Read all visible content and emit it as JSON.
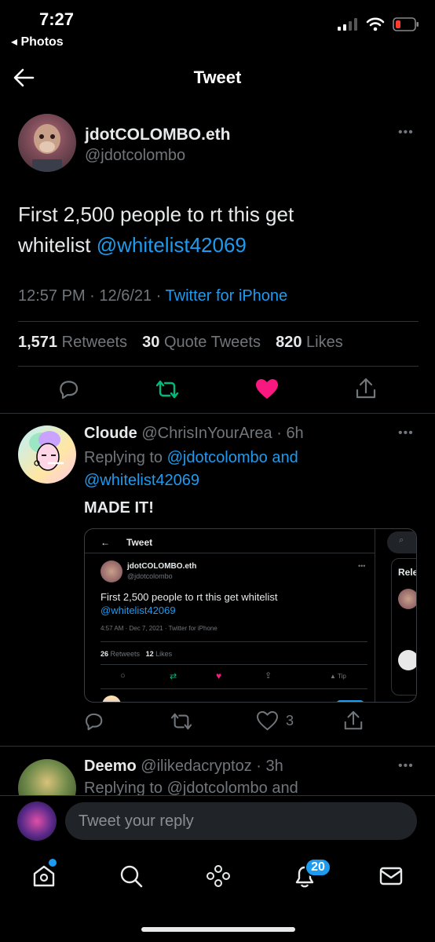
{
  "status_bar": {
    "time": "7:27",
    "back_app": "◂ Photos"
  },
  "header": {
    "title": "Tweet"
  },
  "main_tweet": {
    "display_name": "jdotCOLOMBO.eth",
    "handle": "@jdotcolombo",
    "text_part1": "First 2,500 people to rt this get",
    "text_part2": "whitelist",
    "mention": "@whitelist42069",
    "time": "12:57 PM",
    "date": "12/6/21",
    "source": "Twitter for iPhone",
    "retweets_count": "1,571",
    "retweets_label": "Retweets",
    "quotes_count": "30",
    "quotes_label": "Quote Tweets",
    "likes_count": "820",
    "likes_label": "Likes"
  },
  "reply1": {
    "display_name": "Cloude",
    "handle": "@ChrisInYourArea",
    "age": "6h",
    "replying_label": "Replying to",
    "replying_to1": "@jdotcolombo and",
    "replying_to2": "@whitelist42069",
    "text": "MADE IT!",
    "likes": "3",
    "embed": {
      "title": "Tweet",
      "name": "jdotCOLOMBO.eth",
      "handle": "@jdotcolombo",
      "text": "First 2,500 people to rt this get whitelist",
      "mention": "@whitelist42069",
      "meta": "4:57 AM · Dec 7, 2021 · Twitter for iPhone",
      "rt_count": "26",
      "rt_label": "Retweets",
      "like_count": "12",
      "like_label": "Likes",
      "tip_label": "Tip",
      "side_label": "Rele"
    }
  },
  "reply2": {
    "display_name": "Deemo",
    "handle": "@ilikedacryptoz",
    "age": "3h",
    "replying_partial": "Replying to @jdotcolombo and"
  },
  "composer": {
    "placeholder": "Tweet your reply"
  },
  "tab_bar": {
    "notifications_badge": "20"
  },
  "colors": {
    "accent": "#1d9bf0",
    "like": "#f91880",
    "retweet": "#00ba7c",
    "background": "#000000"
  }
}
